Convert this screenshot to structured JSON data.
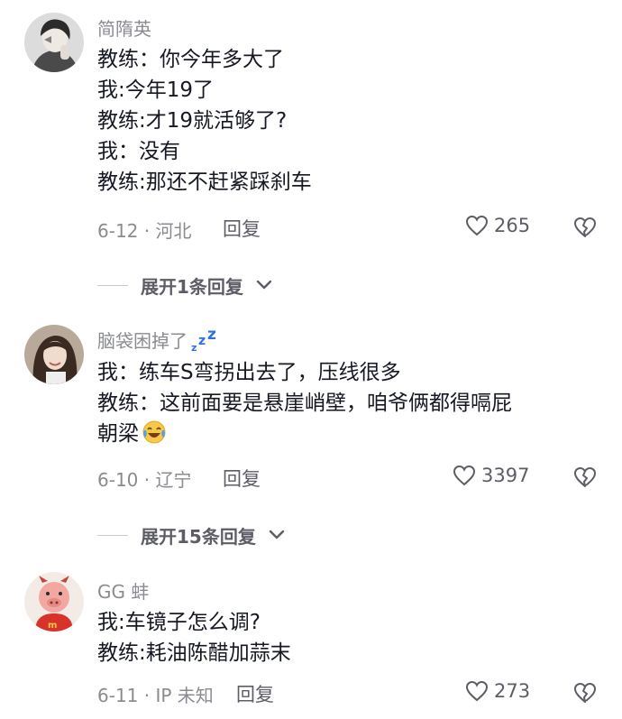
{
  "comments": [
    {
      "username": "简隋英",
      "lines": [
        "教练：你今年多大了",
        "我:今年19了",
        "教练:才19就活够了?",
        "我：没有",
        "教练:那还不赶紧踩刹车"
      ],
      "meta": "6-12 · 河北",
      "reply_label": "回复",
      "likes": "265",
      "expand_label": "展开1条回复"
    },
    {
      "username": "脑袋困掉了",
      "username_suffix_icon": "zzz-sleep-icon",
      "lines": [
        "我：练车S弯拐出去了，压线很多",
        "教练：这前面要是悬崖峭壁，咱爷俩都得嗝屁",
        "朝梁"
      ],
      "inline_emoji": "laugh-cry-emoji",
      "meta": "6-10 · 辽宁",
      "reply_label": "回复",
      "likes": "3397",
      "expand_label": "展开15条回复"
    },
    {
      "username": "GG 蚌",
      "lines": [
        "我:车镜子怎么调?",
        "教练:耗油陈醋加蒜末"
      ],
      "meta": "6-11 · IP 未知",
      "reply_label": "回复",
      "likes": "273"
    }
  ],
  "colors": {
    "text": "#161823",
    "meta": "#8a8b91",
    "secondary": "#5c5d66",
    "zzz": "#2f6fe0"
  }
}
